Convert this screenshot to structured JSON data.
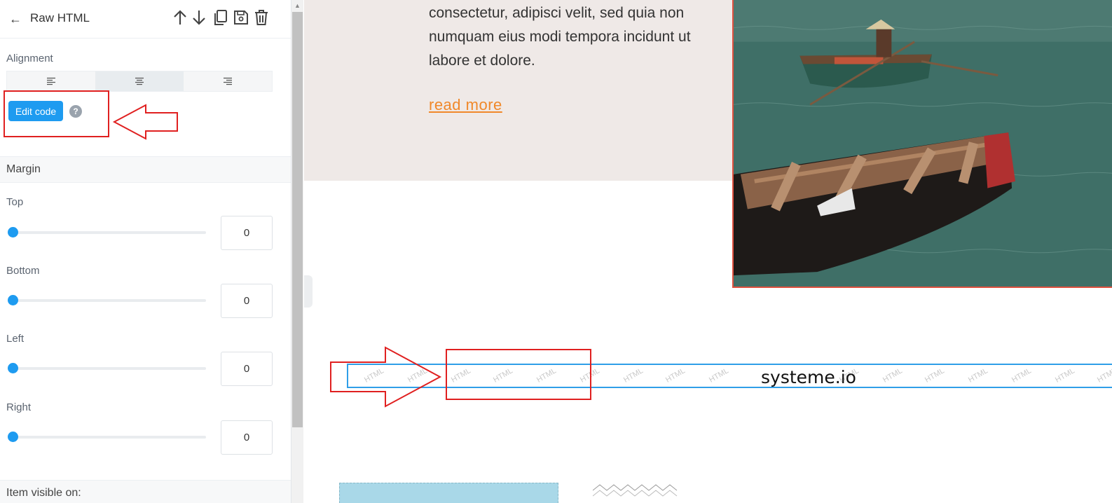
{
  "panel": {
    "title": "Raw HTML",
    "icons": [
      "back-arrow-icon",
      "arrow-up-icon",
      "arrow-down-icon",
      "copy-icon",
      "save-icon",
      "trash-icon"
    ],
    "alignment": {
      "label": "Alignment",
      "options": [
        "align-left",
        "align-center",
        "align-right"
      ],
      "selected": "align-center"
    },
    "edit_code_label": "Edit code",
    "help_label": "?",
    "margin": {
      "label": "Margin",
      "fields": [
        {
          "label": "Top",
          "value": "0"
        },
        {
          "label": "Bottom",
          "value": "0"
        },
        {
          "label": "Left",
          "value": "0"
        },
        {
          "label": "Right",
          "value": "0"
        }
      ]
    },
    "visible_on_label": "Item visible on:"
  },
  "canvas": {
    "hero_text": "consectetur, adipisci velit, sed quia non numquam eius modi tempora incidunt ut labore et dolore.",
    "read_more": "read more",
    "raw_html_label": "systeme.io",
    "watermark": "HTML"
  },
  "colors": {
    "accent": "#1e9bf0",
    "link": "#f0882a",
    "annotation": "#e02020",
    "photo_border": "#e0513f"
  }
}
